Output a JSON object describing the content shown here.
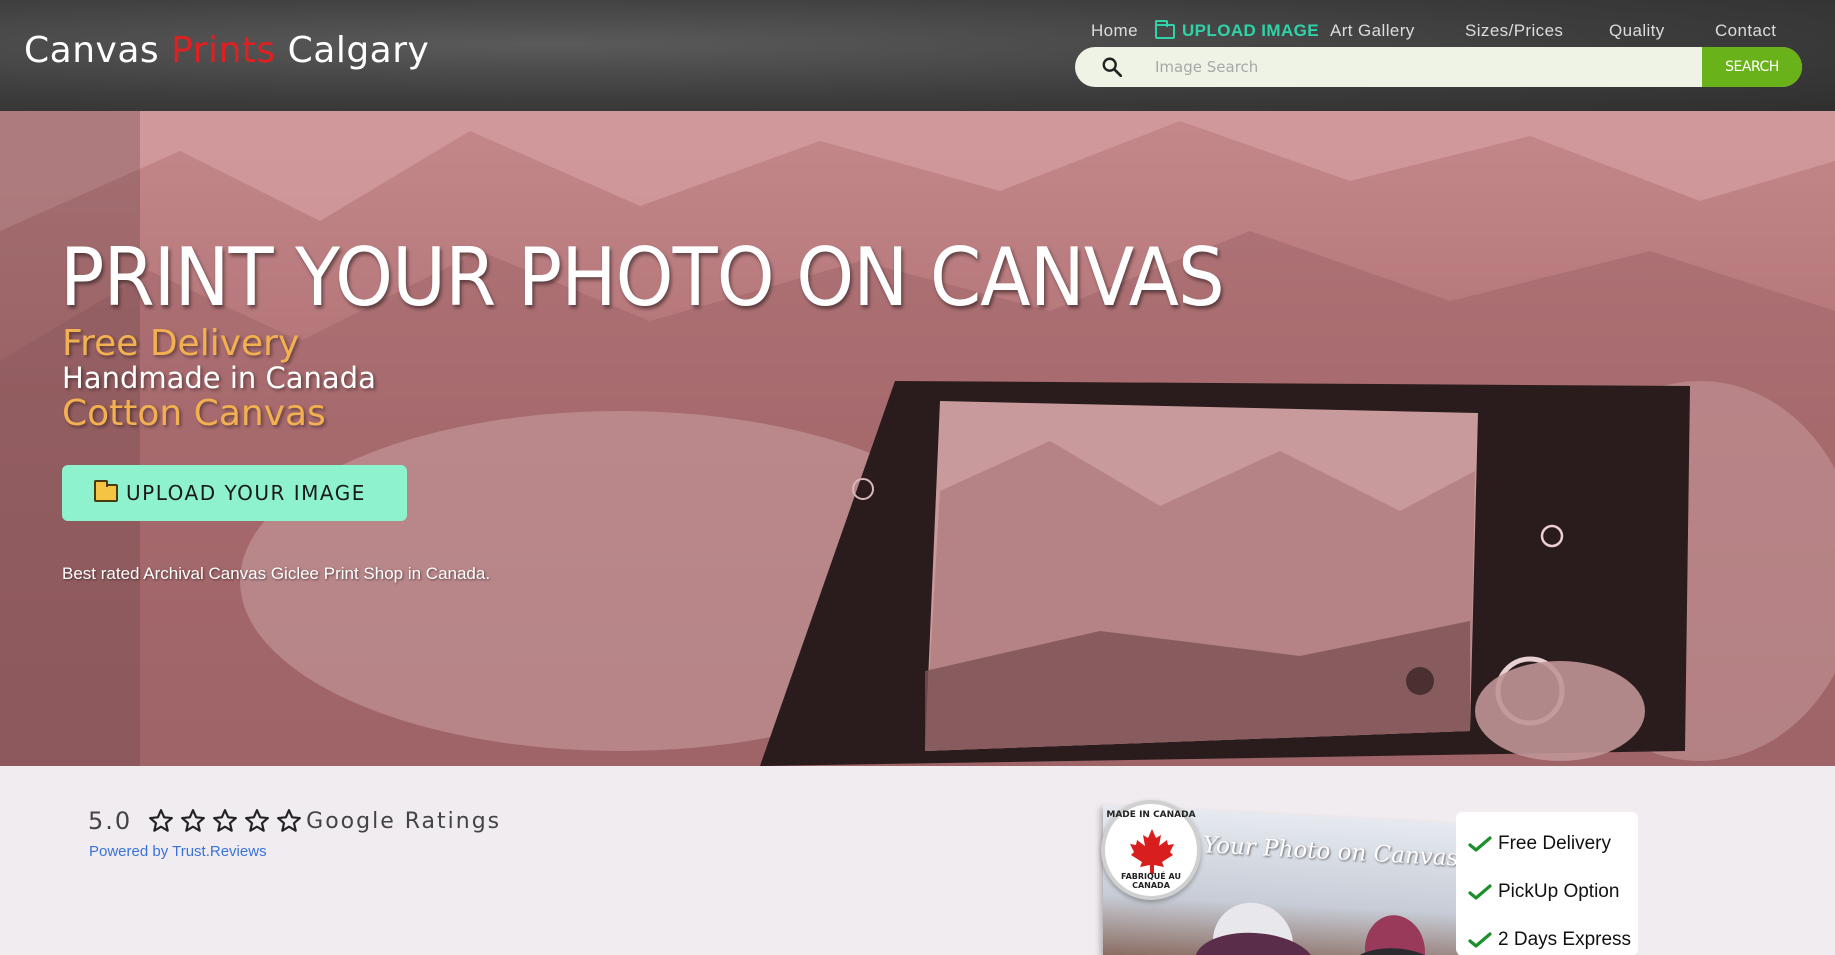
{
  "header": {
    "logo": {
      "part1": "Canvas",
      "part2": "Prints",
      "part3": "Calgary"
    },
    "nav": [
      {
        "label": "Home"
      },
      {
        "label": "UPLOAD IMAGE",
        "icon": "folder-icon"
      },
      {
        "label": "Art Gallery"
      },
      {
        "label": "Sizes/Prices"
      },
      {
        "label": "Quality"
      },
      {
        "label": "Contact"
      }
    ],
    "search": {
      "placeholder": "Image Search",
      "button_label": "SEARCH",
      "icon": "search-icon"
    }
  },
  "hero": {
    "title": "PRINT YOUR PHOTO ON CANVAS",
    "line1": "Free Delivery",
    "line2": "Handmade in Canada",
    "line3": "Cotton Canvas",
    "upload_button": {
      "label": "UPLOAD YOUR IMAGE",
      "icon": "folder-icon"
    },
    "tagline": "Best rated Archival Canvas Giclee Print Shop in Canada."
  },
  "ratings": {
    "score": "5.0",
    "stars": 5,
    "label": "Google Ratings",
    "powered_by": "Powered by Trust.Reviews"
  },
  "promo": {
    "badge_top": "MADE IN CANADA",
    "badge_bottom": "FABRIQUÉ AU CANADA",
    "title": "Your Photo on Canvas"
  },
  "features": [
    {
      "label": "Free Delivery",
      "icon": "check-icon"
    },
    {
      "label": "PickUp Option",
      "icon": "check-icon"
    },
    {
      "label": "2 Days Express",
      "icon": "check-icon"
    }
  ],
  "colors": {
    "header_bg": "#3c3c3c",
    "logo_accent": "#e02020",
    "nav_upload": "#2fd3a7",
    "search_button": "#6ab21a",
    "hero_accent": "#f2b050",
    "upload_button_bg": "#8ef2cf",
    "link": "#3a73d8",
    "check": "#1a8f2a"
  }
}
